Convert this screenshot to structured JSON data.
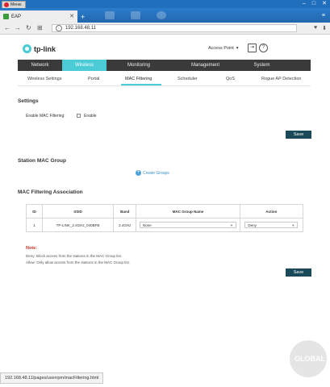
{
  "browser": {
    "menu_label": "Меню",
    "tab_title": "EAP",
    "url": "192.168.48.11",
    "status_url": "192.168.48.11/pages/userrpm/macFiltering.html"
  },
  "header": {
    "logo_text": "tp-link",
    "mode_select": "Access Point"
  },
  "main_nav": [
    "Network",
    "Wireless",
    "Monitoring",
    "Management",
    "System"
  ],
  "main_nav_active": "Wireless",
  "sub_nav": [
    "Wireless Settings",
    "Portal",
    "MAC Filtering",
    "Scheduler",
    "QoS",
    "Rogue AP Detection"
  ],
  "sub_nav_active": "MAC Filtering",
  "settings": {
    "title": "Settings",
    "enable_label": "Enable MAC Filtering:",
    "enable_checkbox_label": "Enable",
    "enable_checked": false,
    "save_label": "Save"
  },
  "station_group": {
    "title": "Station MAC Group",
    "create_label": "Create Groups"
  },
  "association": {
    "title": "MAC Filtering Association",
    "columns": [
      "ID",
      "SSID",
      "Band",
      "MAC Group Name",
      "Action"
    ],
    "rows": [
      {
        "id": "1",
        "ssid": "TP-LINK_2.4GHz_040BFB",
        "band": "2.4GHz",
        "group": "None",
        "action": "Deny"
      }
    ]
  },
  "note": {
    "title": "Note:",
    "deny": "Deny: Block access from the stations in the MAC Group list.",
    "allow": "Allow: Only allow access from the stations in the MAC Group list.",
    "save_label": "Save"
  },
  "watermark_text": "GLOBAL"
}
